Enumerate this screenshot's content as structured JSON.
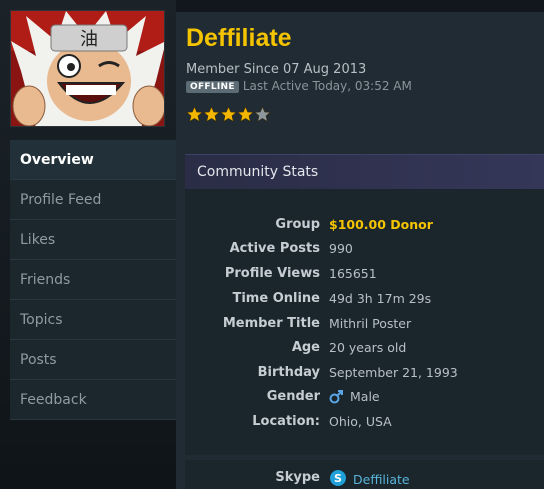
{
  "profile": {
    "username": "Deffiliate",
    "member_since": "Member Since 07 Aug 2013",
    "status_badge": "OFFLINE",
    "last_active": "Last Active Today, 03:52 AM",
    "rating": 4,
    "rating_max": 5
  },
  "nav": {
    "items": [
      {
        "label": "Overview"
      },
      {
        "label": "Profile Feed"
      },
      {
        "label": "Likes"
      },
      {
        "label": "Friends"
      },
      {
        "label": "Topics"
      },
      {
        "label": "Posts"
      },
      {
        "label": "Feedback"
      }
    ]
  },
  "stats": {
    "header": "Community Stats",
    "rows": [
      {
        "label": "Group",
        "value": "$100.00 Donor"
      },
      {
        "label": "Active Posts",
        "value": "990"
      },
      {
        "label": "Profile Views",
        "value": "165651"
      },
      {
        "label": "Time Online",
        "value": "49d 3h 17m 29s"
      },
      {
        "label": "Member Title",
        "value": "Mithril Poster"
      },
      {
        "label": "Age",
        "value": "20 years old"
      },
      {
        "label": "Birthday",
        "value": "September 21, 1993"
      },
      {
        "label": "Gender",
        "value": "Male",
        "icon": "male-symbol-icon"
      },
      {
        "label": "Location:",
        "value": "Ohio, USA"
      }
    ]
  },
  "contact": {
    "label": "Skype",
    "value": "Deffiliate",
    "icon": "skype-icon"
  },
  "colors": {
    "username": "#f5c400",
    "donor": "#f5c400",
    "link": "#58b4d8",
    "star_filled": "#f2b600",
    "star_empty": "#8d979d"
  }
}
